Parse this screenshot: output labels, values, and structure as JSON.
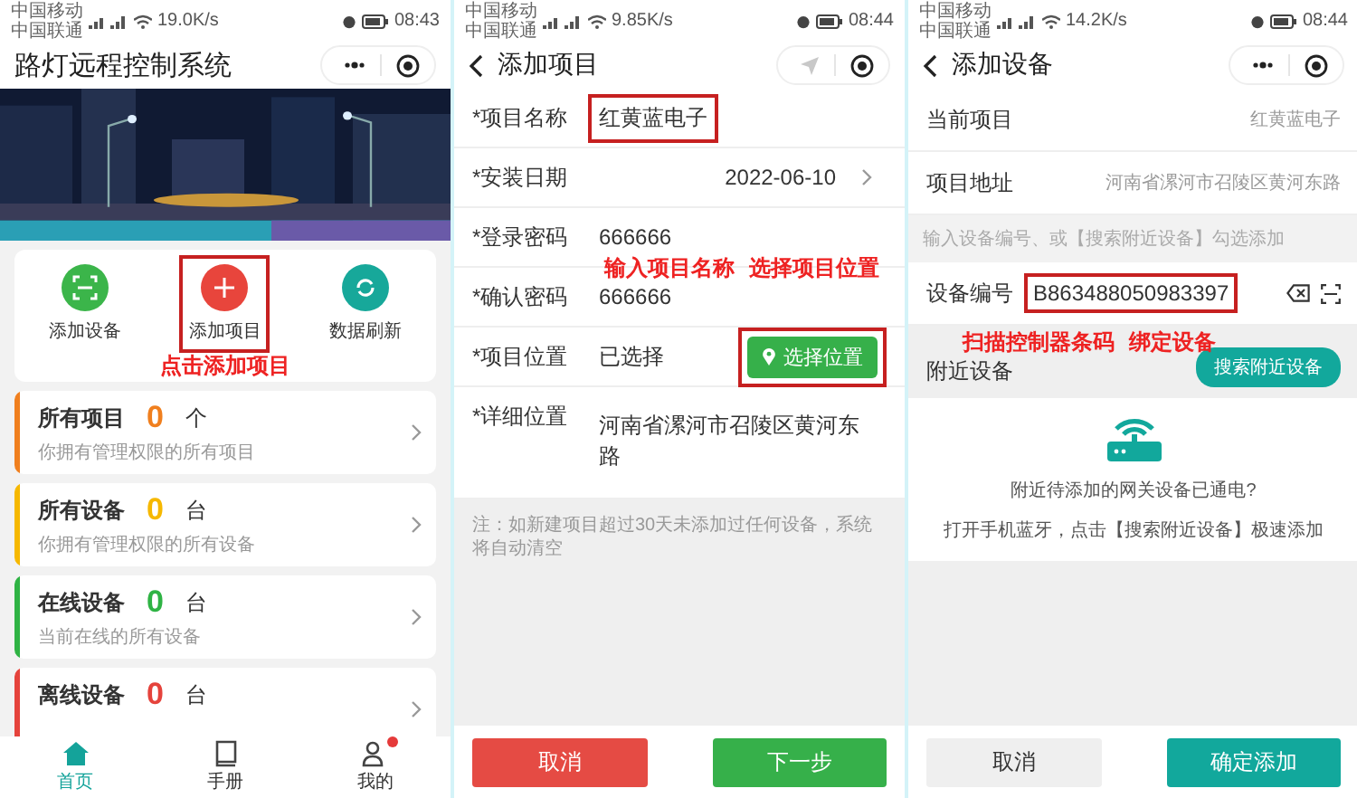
{
  "screens": [
    {
      "kind": "home",
      "status_bar": {
        "carriers": [
          "中国移动",
          "中国联通"
        ],
        "speed": "19.0K/s",
        "time": "08:43"
      },
      "title": "路灯远程控制系统",
      "actions": [
        {
          "label": "添加设备",
          "color": "#3bb54a",
          "highlighted": false
        },
        {
          "label": "添加项目",
          "color": "#e8453c",
          "highlighted": true
        },
        {
          "label": "数据刷新",
          "color": "#17a89a",
          "highlighted": false
        }
      ],
      "annotation": "点击添加项目",
      "stats": [
        {
          "title": "所有项目",
          "count": "0",
          "unit": "个",
          "desc": "你拥有管理权限的所有项目",
          "color": "#f07f1e"
        },
        {
          "title": "所有设备",
          "count": "0",
          "unit": "台",
          "desc": "你拥有管理权限的所有设备",
          "color": "#f6b800"
        },
        {
          "title": "在线设备",
          "count": "0",
          "unit": "台",
          "desc": "当前在线的所有设备",
          "color": "#2fb344"
        },
        {
          "title": "离线设备",
          "count": "0",
          "unit": "台",
          "color": "#e5433c"
        }
      ],
      "tabs": [
        {
          "label": "首页",
          "selected": true,
          "badge": false
        },
        {
          "label": "手册",
          "selected": false,
          "badge": false
        },
        {
          "label": "我的",
          "selected": false,
          "badge": true
        }
      ]
    },
    {
      "kind": "add_project",
      "status_bar": {
        "carriers": [
          "中国移动",
          "中国联通"
        ],
        "speed": "9.85K/s",
        "time": "08:44"
      },
      "title": "添加项目",
      "fields": [
        {
          "kind": "text",
          "label": "*项目名称",
          "value": "红黄蓝电子",
          "highlighted": true
        },
        {
          "kind": "date",
          "label": "*安装日期",
          "value": "2022-06-10",
          "highlighted": false
        },
        {
          "kind": "text",
          "label": "*登录密码",
          "value": "666666",
          "highlighted": false
        },
        {
          "kind": "text",
          "label": "*确认密码",
          "value": "666666",
          "highlighted": false
        },
        {
          "kind": "location",
          "label": "*项目位置",
          "value": "已选择",
          "button": "选择位置",
          "highlighted": true
        },
        {
          "kind": "textarea",
          "label": "*详细位置",
          "value": "河南省漯河市召陵区黄河东路",
          "highlighted": false
        }
      ],
      "annotations": [
        "输入项目名称",
        "选择项目位置"
      ],
      "note": "注：如新建项目超过30天未添加过任何设备，系统将自动清空",
      "buttons": [
        {
          "label": "取消",
          "kind": "danger"
        },
        {
          "label": "下一步",
          "kind": "primary"
        }
      ]
    },
    {
      "kind": "add_device",
      "status_bar": {
        "carriers": [
          "中国移动",
          "中国联通"
        ],
        "speed": "14.2K/s",
        "time": "08:44"
      },
      "title": "添加设备",
      "info": [
        {
          "label": "当前项目",
          "value": "红黄蓝电子"
        },
        {
          "label": "项目地址",
          "value": "河南省漯河市召陵区黄河东路"
        }
      ],
      "hint": "输入设备编号、或【搜索附近设备】勾选添加",
      "device_id": {
        "label": "设备编号",
        "value": "B863488050983397",
        "highlighted": true
      },
      "annotations": [
        "扫描控制器条码",
        "绑定设备"
      ],
      "nearby": {
        "label": "附近设备",
        "button": "搜索附近设备"
      },
      "empty_lines": [
        "附近待添加的网关设备已通电?",
        "打开手机蓝牙，点击【搜索附近设备】极速添加"
      ],
      "buttons": [
        {
          "label": "取消",
          "kind": "secondary"
        },
        {
          "label": "确定添加",
          "kind": "teal"
        }
      ]
    }
  ]
}
